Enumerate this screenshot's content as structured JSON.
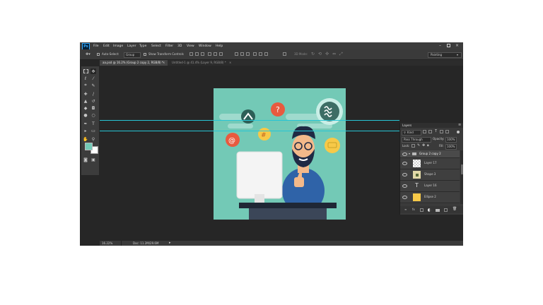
{
  "menubar": {
    "logo": "Ps",
    "items": [
      "File",
      "Edit",
      "Image",
      "Layer",
      "Type",
      "Select",
      "Filter",
      "3D",
      "View",
      "Window",
      "Help"
    ]
  },
  "options": {
    "auto_select": "Auto-Select:",
    "group": "Group",
    "show_transform": "Show Transform Controls",
    "mode_3d": "3D Mode:",
    "workspace": "Painting"
  },
  "tabs": [
    {
      "label": "aa.psd @ 16.2% (Group 2 copy 2, RGB/8) *"
    },
    {
      "label": "Untitled-1 @ 41.4% (Layer 9, RGB/8) *"
    }
  ],
  "status": {
    "zoom": "16.22%",
    "doc": "Doc: 11.2M/29.6M"
  },
  "layers_panel": {
    "title": "Layers",
    "kind": "Kind",
    "blend": "Pass Through",
    "opacity_label": "Opacity:",
    "opacity": "100%",
    "lock_label": "Lock:",
    "fill_label": "Fill:",
    "fill": "100%",
    "group_name": "Group 2 copy 2",
    "layers": [
      {
        "name": "Layer 17",
        "thumb": "checker"
      },
      {
        "name": "Shape 3",
        "thumb": "shape"
      },
      {
        "name": "Layer 16",
        "thumb": "type"
      },
      {
        "name": "Ellipse 2",
        "thumb": "ellipse"
      }
    ]
  },
  "colors": {
    "foreground": "#73c9b6",
    "background": "#ffffff",
    "artboard": "#73c9b6",
    "guides": "#27c5d5"
  }
}
